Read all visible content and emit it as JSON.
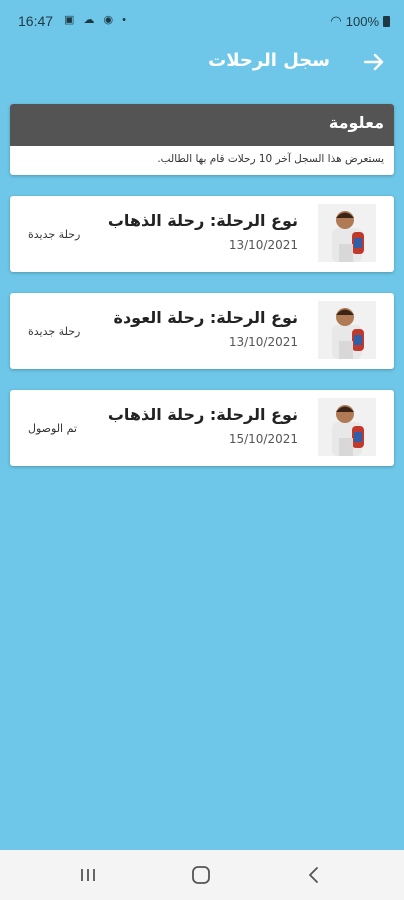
{
  "status_bar": {
    "time": "16:47",
    "left_icons": [
      "image-icon",
      "cloud-icon",
      "globe-icon",
      "dot-icon"
    ],
    "battery": "100%"
  },
  "app_bar": {
    "title": "سجل الرحلات"
  },
  "info": {
    "title": "معلومة",
    "text": "يستعرض هذا السجل آخر 10 رحلات قام بها الطالب."
  },
  "trips": [
    {
      "type": "نوع الرحلة: رحلة الذهاب",
      "date": "13/10/2021",
      "status": "رحلة جديدة"
    },
    {
      "type": "نوع الرحلة: رحلة العودة",
      "date": "13/10/2021",
      "status": "رحلة جديدة"
    },
    {
      "type": "نوع الرحلة: رحلة الذهاب",
      "date": "15/10/2021",
      "status": "تم الوصول"
    }
  ],
  "colors": {
    "background": "#6ec7e8",
    "info_header": "#545454",
    "card": "#ffffff"
  }
}
